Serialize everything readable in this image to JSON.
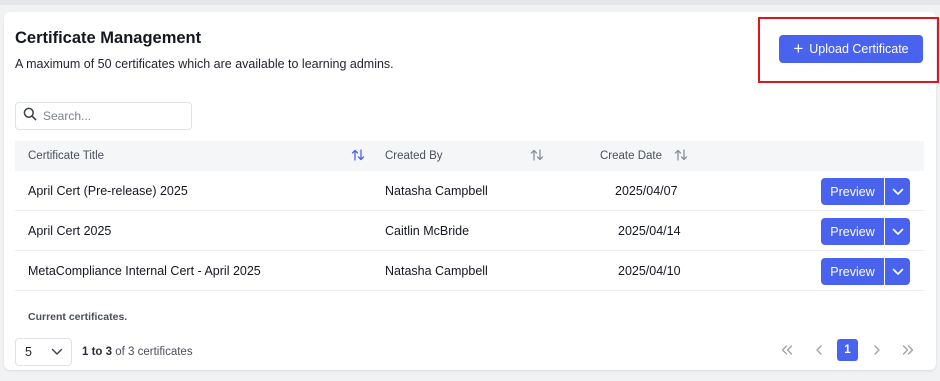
{
  "header": {
    "title": "Certificate Management",
    "subtitle": "A maximum of 50 certificates which are available to learning admins.",
    "upload_label": "Upload Certificate"
  },
  "search": {
    "placeholder": "Search..."
  },
  "table": {
    "columns": [
      "Certificate Title",
      "Created By",
      "Create Date"
    ],
    "rows": [
      {
        "title": "April Cert (Pre-release) 2025",
        "created_by": "Natasha Campbell",
        "date": "2025/04/07",
        "action": "Preview"
      },
      {
        "title": "April Cert 2025",
        "created_by": "Caitlin McBride",
        "date": "2025/04/14",
        "action": "Preview"
      },
      {
        "title": "MetaCompliance Internal Cert - April 2025",
        "created_by": "Natasha Campbell",
        "date": "2025/04/10",
        "action": "Preview"
      }
    ],
    "caption": "Current certificates."
  },
  "footer": {
    "page_size": "5",
    "range_bold": "1 to 3",
    "range_rest": " of 3 certificates",
    "current_page": "1"
  },
  "colors": {
    "accent": "#4a63ef",
    "highlight": "#e0141c",
    "sort_active": "#4a63ef",
    "sort_inactive": "#8a8f99"
  }
}
